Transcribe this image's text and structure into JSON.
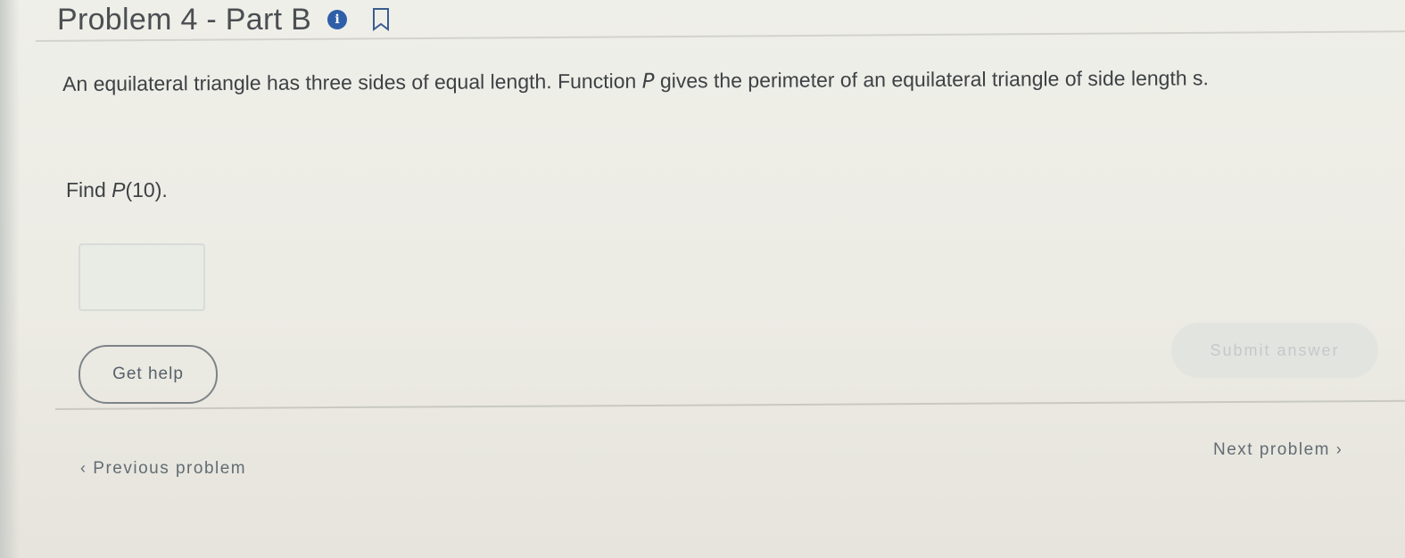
{
  "header": {
    "title": "Problem 4 - Part B",
    "info_icon": "i",
    "icons": [
      "info-icon",
      "bookmark-icon"
    ],
    "accent_color": "#2f5fa8"
  },
  "problem": {
    "prompt": "An equilateral triangle has three sides of equal length. Function P gives the perimeter of an equilateral triangle of side length s.",
    "prompt_parts": {
      "a": "An equilateral triangle has three sides of equal length. Function ",
      "P": "P",
      "b": " gives the perimeter of an equilateral triangle of side length s."
    },
    "question_prefix": "Find ",
    "question_function": "P",
    "question_arg": "(10).",
    "answer_value": ""
  },
  "actions": {
    "get_help": "Get help",
    "submit": "Submit answer"
  },
  "navigation": {
    "prev_chevron": "‹",
    "previous": "Previous problem",
    "next": "Next problem",
    "next_chevron": "›"
  }
}
